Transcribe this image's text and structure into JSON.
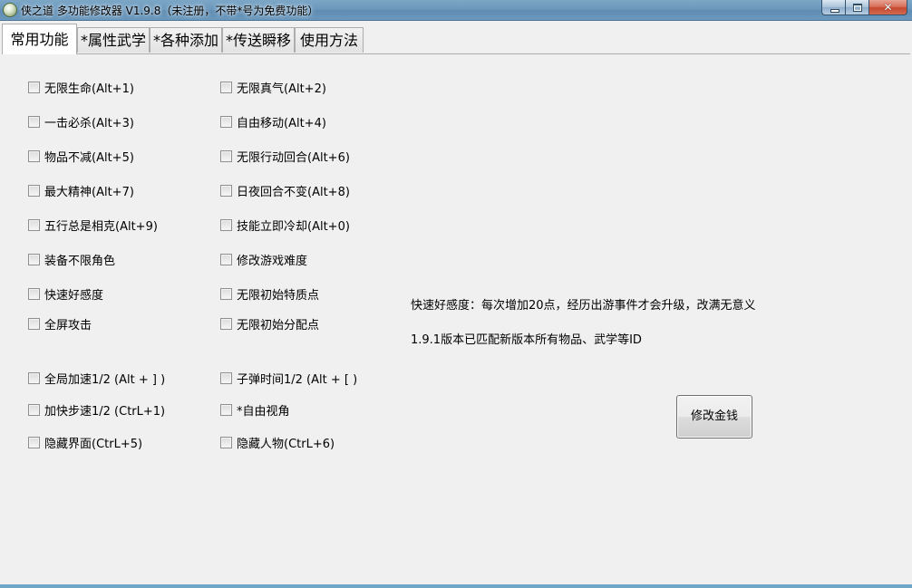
{
  "window": {
    "title": "侠之道 多功能修改器 V1.9.8（未注册，不带*号为免费功能）"
  },
  "tabs": [
    {
      "label": "常用功能"
    },
    {
      "label": "*属性武学"
    },
    {
      "label": "*各种添加"
    },
    {
      "label": "*传送瞬移"
    },
    {
      "label": "使用方法"
    }
  ],
  "options": [
    {
      "label": "无限生命(Alt+1)"
    },
    {
      "label": "无限真气(Alt+2)"
    },
    {
      "label": "一击必杀(Alt+3)"
    },
    {
      "label": "自由移动(Alt+4)"
    },
    {
      "label": "物品不减(Alt+5)"
    },
    {
      "label": "无限行动回合(Alt+6)"
    },
    {
      "label": "最大精神(Alt+7)"
    },
    {
      "label": "日夜回合不变(Alt+8)"
    },
    {
      "label": "五行总是相克(Alt+9)"
    },
    {
      "label": "技能立即冷却(Alt+0)"
    },
    {
      "label": "装备不限角色"
    },
    {
      "label": "修改游戏难度"
    },
    {
      "label": "快速好感度"
    },
    {
      "label": "无限初始特质点"
    },
    {
      "label": "全屏攻击"
    },
    {
      "label": "无限初始分配点"
    },
    {
      "label": "全局加速1/2 (Alt + ] )"
    },
    {
      "label": "子弹时间1/2 (Alt + [ )"
    },
    {
      "label": "加快步速1/2 (CtrL+1)"
    },
    {
      "label": "*自由视角"
    },
    {
      "label": "隐藏界面(CtrL+5)"
    },
    {
      "label": "隐藏人物(CtrL+6)"
    }
  ],
  "info": {
    "line1": "快速好感度：每次增加20点，经历出游事件才会升级，改满无意义",
    "line2": "1.9.1版本已匹配新版本所有物品、武学等ID"
  },
  "buttons": {
    "modify_money": "修改金钱"
  },
  "icons": {
    "app": "app-icon",
    "minimize": "minimize-icon",
    "maximize": "maximize-icon",
    "close": "close-icon"
  }
}
